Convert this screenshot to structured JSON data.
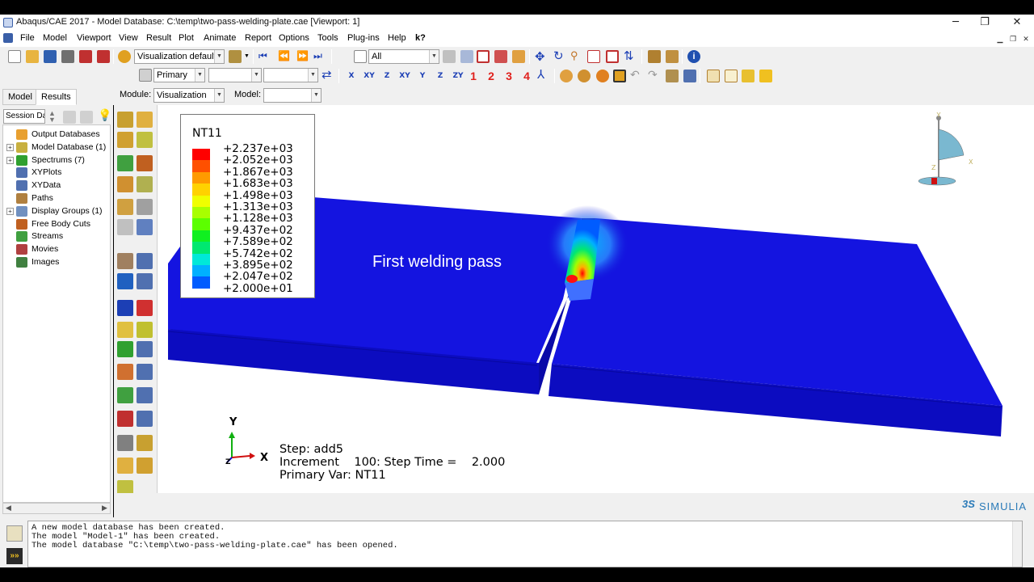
{
  "window": {
    "title": "Abaqus/CAE 2017 - Model Database: C:\\temp\\two-pass-welding-plate.cae [Viewport: 1]",
    "controls": [
      "─",
      "❐",
      "✕"
    ]
  },
  "menubar": {
    "items": [
      "File",
      "Model",
      "Viewport",
      "View",
      "Result",
      "Plot",
      "Animate",
      "Report",
      "Options",
      "Tools",
      "Plug-ins",
      "Help",
      "k?"
    ]
  },
  "toolbar1": {
    "visualization_defaults": "Visualization defaults",
    "selection_filter": "All"
  },
  "toolbar2": {
    "primary_combo": "Primary",
    "numbered_buttons": [
      "1",
      "2",
      "3",
      "4"
    ],
    "coord_buttons": [
      "X",
      "XY",
      "Z",
      "XY",
      "Y",
      "Z",
      "ZY"
    ]
  },
  "module_row": {
    "module_label": "Module:",
    "module_value": "Visualization",
    "model_label": "Model:",
    "model_value": ""
  },
  "left_panel": {
    "tabs": [
      "Model",
      "Results"
    ],
    "active_tab": "Results",
    "session_combo": "Session Da",
    "tree": [
      {
        "label": "Output Databases",
        "expandable": false,
        "icon": "database-icon",
        "color": "#e8a030"
      },
      {
        "label": "Model Database (1)",
        "expandable": true,
        "icon": "database-icon",
        "color": "#c8b040"
      },
      {
        "label": "Spectrums (7)",
        "expandable": true,
        "icon": "spectrum-icon",
        "color": "#30a030"
      },
      {
        "label": "XYPlots",
        "expandable": false,
        "icon": "grid-icon",
        "color": "#5070b0"
      },
      {
        "label": "XYData",
        "expandable": false,
        "icon": "grid-icon",
        "color": "#5070b0"
      },
      {
        "label": "Paths",
        "expandable": false,
        "icon": "path-icon",
        "color": "#b08040"
      },
      {
        "label": "Display Groups (1)",
        "expandable": true,
        "icon": "display-group-icon",
        "color": "#7090c0"
      },
      {
        "label": "Free Body Cuts",
        "expandable": false,
        "icon": "free-body-icon",
        "color": "#c06020"
      },
      {
        "label": "Streams",
        "expandable": false,
        "icon": "stream-icon",
        "color": "#40a040"
      },
      {
        "label": "Movies",
        "expandable": false,
        "icon": "movie-icon",
        "color": "#b04040"
      },
      {
        "label": "Images",
        "expandable": false,
        "icon": "image-icon",
        "color": "#408040"
      }
    ]
  },
  "legend": {
    "title": "NT11",
    "values": [
      "+2.237e+03",
      "+2.052e+03",
      "+1.867e+03",
      "+1.683e+03",
      "+1.498e+03",
      "+1.313e+03",
      "+1.128e+03",
      "+9.437e+02",
      "+7.589e+02",
      "+5.742e+02",
      "+3.895e+02",
      "+2.047e+02",
      "+2.000e+01"
    ],
    "colors": [
      "#ff0000",
      "#ff5000",
      "#ff9a00",
      "#ffd200",
      "#f0ff00",
      "#a8ff00",
      "#5cff00",
      "#10f020",
      "#00e870",
      "#00e8d8",
      "#00b0ff",
      "#005cff",
      "#0a14e6"
    ]
  },
  "viewport": {
    "annotation": "First welding pass",
    "axis_labels": {
      "y": "Y",
      "x": "X",
      "z": "Z"
    },
    "step_line": "Step: add5",
    "increment_line": "Increment    100: Step Time =    2.000",
    "primary_var_line": "Primary Var: NT11",
    "plate_color": "#1010d8"
  },
  "brand": {
    "logo_text": "SIMULIA",
    "logo_mark": "3S"
  },
  "messages": [
    "A new model database has been created.",
    "The model \"Model-1\" has been created.",
    "The model database \"C:\\temp\\two-pass-welding-plate.cae\" has been opened."
  ]
}
